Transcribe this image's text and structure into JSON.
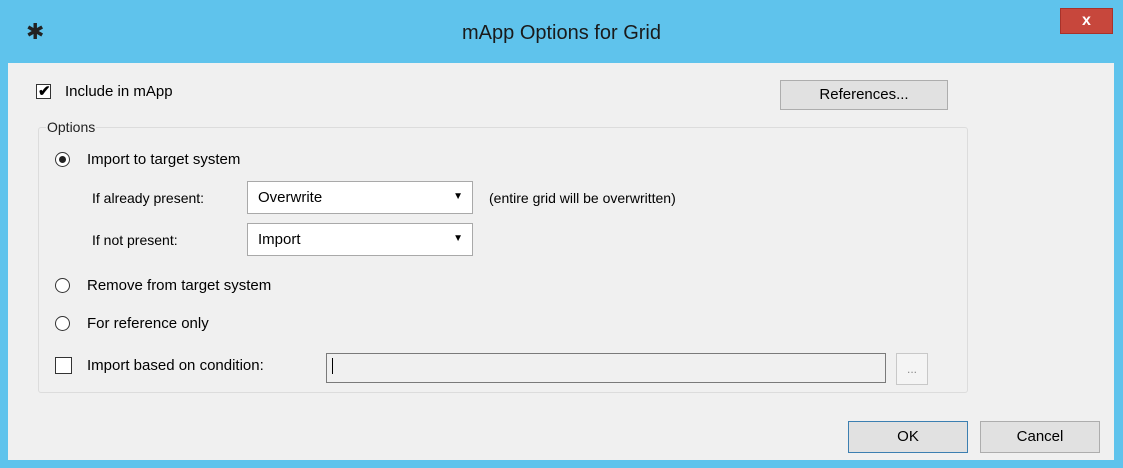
{
  "window": {
    "title": "mApp Options for Grid",
    "icon": "puzzle-icon",
    "close_label": "x"
  },
  "include": {
    "label": "Include in mApp",
    "checked": true
  },
  "references_button": "References...",
  "options": {
    "legend": "Options",
    "import_radio": "Import to target system",
    "if_already_present_label": "If already present:",
    "if_already_present_value": "Overwrite",
    "overwrite_note": "(entire grid will be overwritten)",
    "if_not_present_label": "If not present:",
    "if_not_present_value": "Import",
    "remove_radio": "Remove from target system",
    "reference_radio": "For reference only",
    "condition_label": "Import based on condition:",
    "condition_value": "",
    "condition_browse": "..."
  },
  "footer": {
    "ok_label": "OK",
    "cancel_label": "Cancel"
  }
}
